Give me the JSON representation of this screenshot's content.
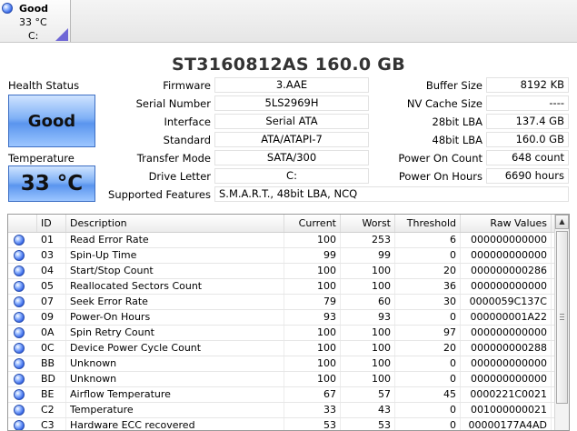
{
  "disk_tab": {
    "status": "Good",
    "temperature": "33 °C",
    "drive": "C:"
  },
  "model_title": "ST3160812AS  160.0 GB",
  "health": {
    "label": "Health Status",
    "value": "Good"
  },
  "temperature": {
    "label": "Temperature",
    "value": "33 °C"
  },
  "fields": {
    "firmware": {
      "label": "Firmware",
      "value": "3.AAE"
    },
    "serial": {
      "label": "Serial Number",
      "value": "5LS2969H"
    },
    "interface": {
      "label": "Interface",
      "value": "Serial ATA"
    },
    "standard": {
      "label": "Standard",
      "value": "ATA/ATAPI-7"
    },
    "transfer": {
      "label": "Transfer Mode",
      "value": "SATA/300"
    },
    "drive_letter": {
      "label": "Drive Letter",
      "value": "C:"
    },
    "features": {
      "label": "Supported Features",
      "value": "S.M.A.R.T., 48bit LBA, NCQ"
    },
    "buffer": {
      "label": "Buffer Size",
      "value": "8192 KB"
    },
    "nvcache": {
      "label": "NV Cache Size",
      "value": "----"
    },
    "lba28": {
      "label": "28bit LBA",
      "value": "137.4 GB"
    },
    "lba48": {
      "label": "48bit LBA",
      "value": "160.0 GB"
    },
    "power_count": {
      "label": "Power On Count",
      "value": "648 count"
    },
    "power_hours": {
      "label": "Power On Hours",
      "value": "6690 hours"
    }
  },
  "smart_table": {
    "columns": [
      "ID",
      "Description",
      "Current",
      "Worst",
      "Threshold",
      "Raw Values"
    ],
    "rows": [
      {
        "id": "01",
        "desc": "Read Error Rate",
        "current": "100",
        "worst": "253",
        "threshold": "6",
        "raw": "000000000000"
      },
      {
        "id": "03",
        "desc": "Spin-Up Time",
        "current": "99",
        "worst": "99",
        "threshold": "0",
        "raw": "000000000000"
      },
      {
        "id": "04",
        "desc": "Start/Stop Count",
        "current": "100",
        "worst": "100",
        "threshold": "20",
        "raw": "000000000286"
      },
      {
        "id": "05",
        "desc": "Reallocated Sectors Count",
        "current": "100",
        "worst": "100",
        "threshold": "36",
        "raw": "000000000000"
      },
      {
        "id": "07",
        "desc": "Seek Error Rate",
        "current": "79",
        "worst": "60",
        "threshold": "30",
        "raw": "0000059C137C"
      },
      {
        "id": "09",
        "desc": "Power-On Hours",
        "current": "93",
        "worst": "93",
        "threshold": "0",
        "raw": "000000001A22"
      },
      {
        "id": "0A",
        "desc": "Spin Retry Count",
        "current": "100",
        "worst": "100",
        "threshold": "97",
        "raw": "000000000000"
      },
      {
        "id": "0C",
        "desc": "Device Power Cycle Count",
        "current": "100",
        "worst": "100",
        "threshold": "20",
        "raw": "000000000288"
      },
      {
        "id": "BB",
        "desc": "Unknown",
        "current": "100",
        "worst": "100",
        "threshold": "0",
        "raw": "000000000000"
      },
      {
        "id": "BD",
        "desc": "Unknown",
        "current": "100",
        "worst": "100",
        "threshold": "0",
        "raw": "000000000000"
      },
      {
        "id": "BE",
        "desc": "Airflow Temperature",
        "current": "67",
        "worst": "57",
        "threshold": "45",
        "raw": "0000221C0021"
      },
      {
        "id": "C2",
        "desc": "Temperature",
        "current": "33",
        "worst": "43",
        "threshold": "0",
        "raw": "001000000021"
      },
      {
        "id": "C3",
        "desc": "Hardware ECC recovered",
        "current": "53",
        "worst": "53",
        "threshold": "0",
        "raw": "00000177A4AD"
      }
    ]
  }
}
